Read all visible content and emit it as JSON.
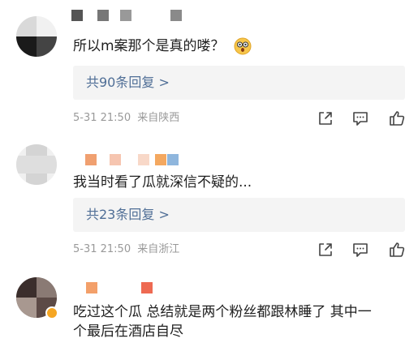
{
  "comments": [
    {
      "text": "所以m案那个是真的喽？",
      "emoji": "astonished-emoji",
      "replies": "共90条回复 >",
      "time": "5-31 21:50",
      "location": "来自陕西"
    },
    {
      "text": "我当时看了瓜就深信不疑的...",
      "replies": "共23条回复 >",
      "time": "5-31 21:50",
      "location": "来自浙江"
    },
    {
      "text_line1": "吃过这个瓜 总结就是两个粉丝都跟林睡了 其中一",
      "text_line2": "个最后在酒店自尽",
      "badge": "vip-badge"
    }
  ],
  "icons": {
    "share": "share-icon",
    "comment": "comment-icon",
    "like": "thumbs-up-icon"
  },
  "colors": {
    "reply_link": "#4f6e96",
    "meta": "#999999",
    "reply_bg": "#f4f4f4",
    "badge": "#f5a623"
  }
}
